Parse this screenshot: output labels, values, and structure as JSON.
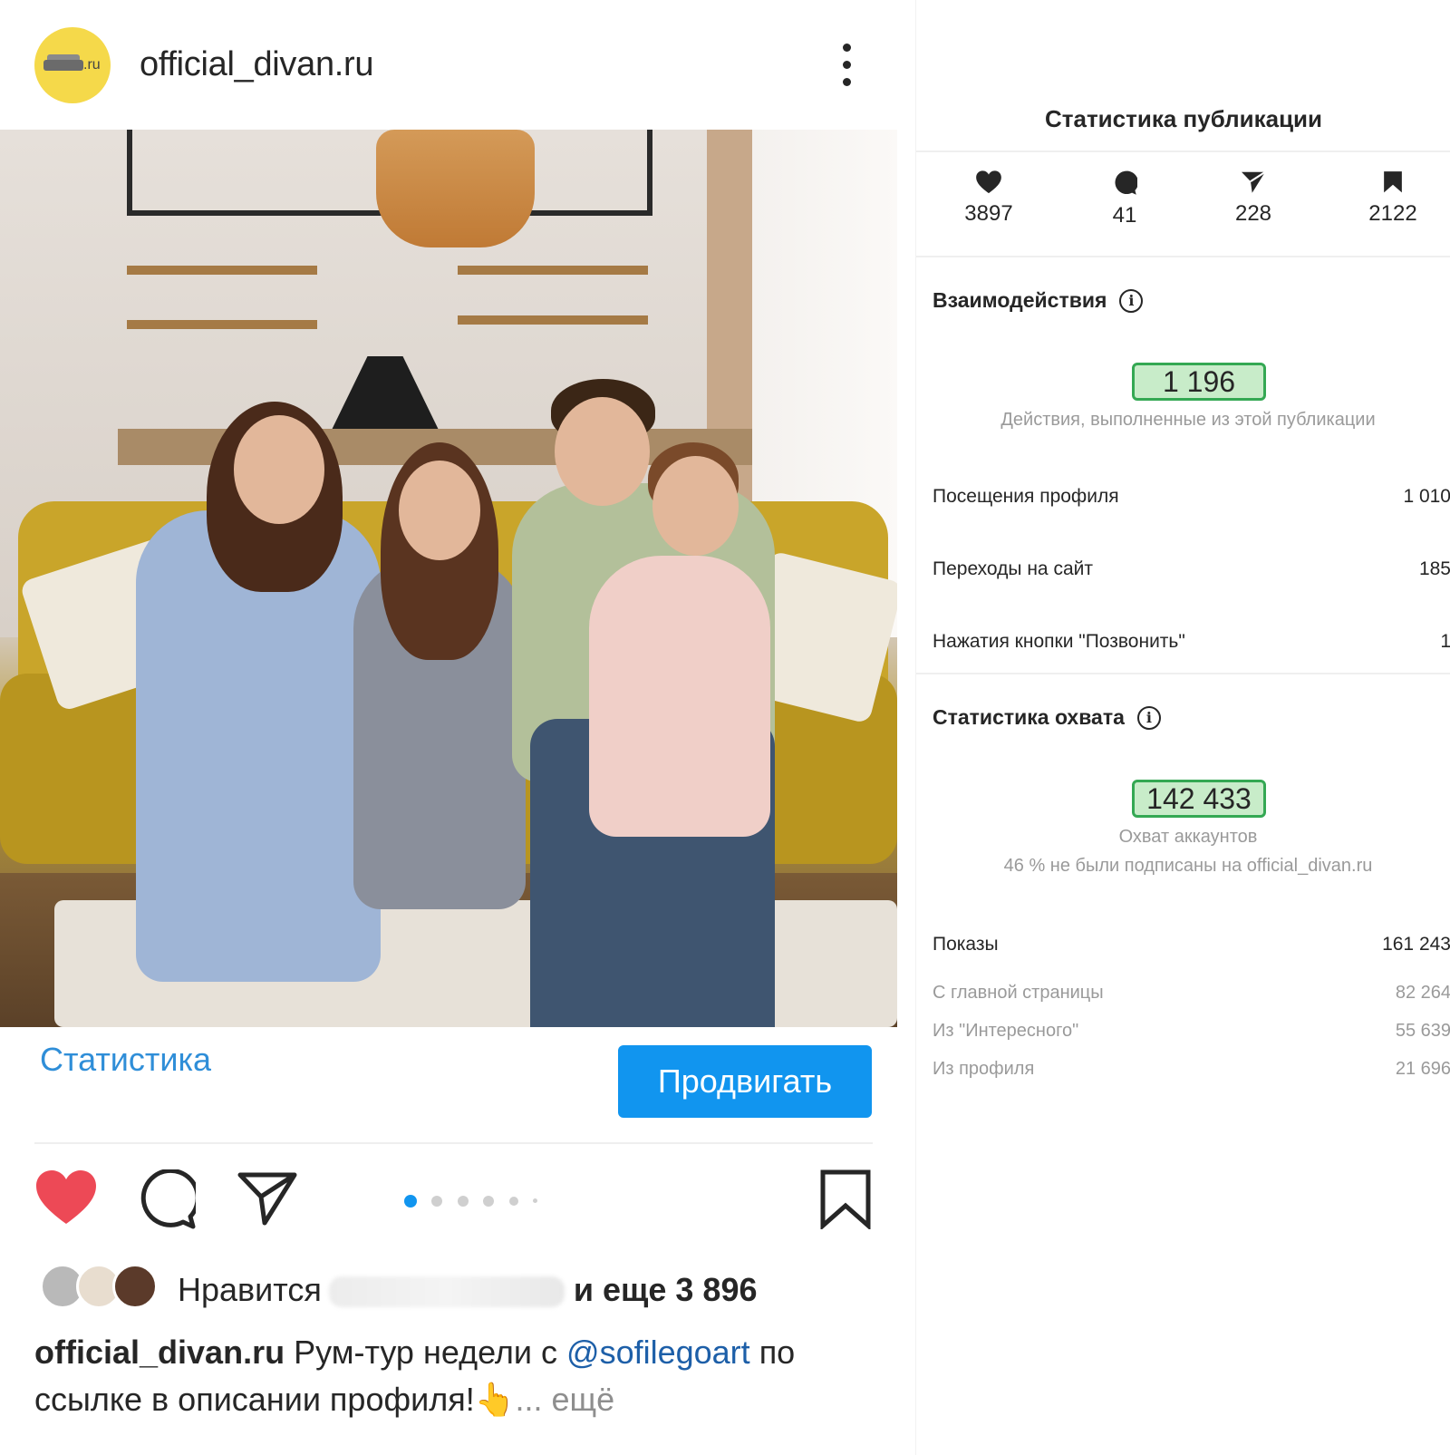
{
  "post": {
    "username": "official_divan.ru",
    "avatar_label": ".ru",
    "stats_link": "Статистика",
    "promote_label": "Продвигать",
    "carousel": {
      "count": 6,
      "active_index": 0
    },
    "likes": {
      "prefix": "Нравится",
      "suffix": "и еще 3 896"
    },
    "caption": {
      "username": "official_divan.ru",
      "text_before": "Рум-тур недели с",
      "mention": "@sofilegoart",
      "text_after": "по ссылке в описании профиля!👆",
      "more": "... ещё"
    }
  },
  "stats": {
    "title": "Статистика публикации",
    "metrics": [
      {
        "icon": "heart-icon",
        "value": "3897"
      },
      {
        "icon": "comment-icon",
        "value": "41"
      },
      {
        "icon": "share-icon",
        "value": "228"
      },
      {
        "icon": "bookmark-icon",
        "value": "2122"
      }
    ],
    "interactions": {
      "title": "Взаимодействия",
      "total": "1 196",
      "subtitle": "Действия, выполненные из этой публикации",
      "rows": [
        {
          "label": "Посещения профиля",
          "value": "1 010"
        },
        {
          "label": "Переходы на сайт",
          "value": "185"
        },
        {
          "label": "Нажатия кнопки \"Позвонить\"",
          "value": "1"
        }
      ]
    },
    "reach": {
      "title": "Статистика охвата",
      "total": "142 433",
      "subtitle": "Охват аккаунтов",
      "subtitle2": "46 % не были подписаны на official_divan.ru",
      "impressions_label": "Показы",
      "impressions_value": "161 243",
      "rows": [
        {
          "label": "С главной страницы",
          "value": "82 264"
        },
        {
          "label": "Из \"Интересного\"",
          "value": "55 639"
        },
        {
          "label": "Из профиля",
          "value": "21 696"
        }
      ]
    }
  },
  "colors": {
    "accent": "#1195ef",
    "link": "#2f8ed8",
    "heart": "#ed4956",
    "highlight_border": "#34a853",
    "highlight_fill": "#c8ecc9"
  }
}
